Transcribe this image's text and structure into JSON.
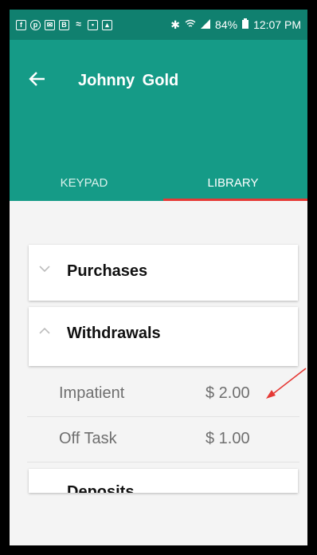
{
  "status_bar": {
    "notification_icons": [
      "facebook-icon",
      "pinterest-icon",
      "mail-icon",
      "b-icon",
      "voicemail-icon",
      "image-card-icon",
      "picture-icon"
    ],
    "bluetooth_icon": "bluetooth-icon",
    "wifi_icon": "wifi-icon",
    "signal_icon": "signal-icon",
    "battery": "84%",
    "time": "12:07 PM"
  },
  "header": {
    "back_icon": "back-arrow-icon",
    "title": "Johnny Gold"
  },
  "tabs": [
    {
      "label": "KEYPAD",
      "selected": false
    },
    {
      "label": "LIBRARY",
      "selected": true
    }
  ],
  "library": {
    "sections": [
      {
        "label": "Purchases",
        "expanded": false
      },
      {
        "label": "Withdrawals",
        "expanded": true
      },
      {
        "label": "Deposits",
        "expanded": false
      }
    ],
    "withdrawal_items": [
      {
        "label": "Impatient",
        "value": "$ 2.00"
      },
      {
        "label": "Off Task",
        "value": "$ 1.00"
      }
    ]
  },
  "colors": {
    "status_bar": "#10806f",
    "app_bar": "#159b87",
    "tab_indicator": "#e53935",
    "annotation_arrow": "#e53935"
  }
}
